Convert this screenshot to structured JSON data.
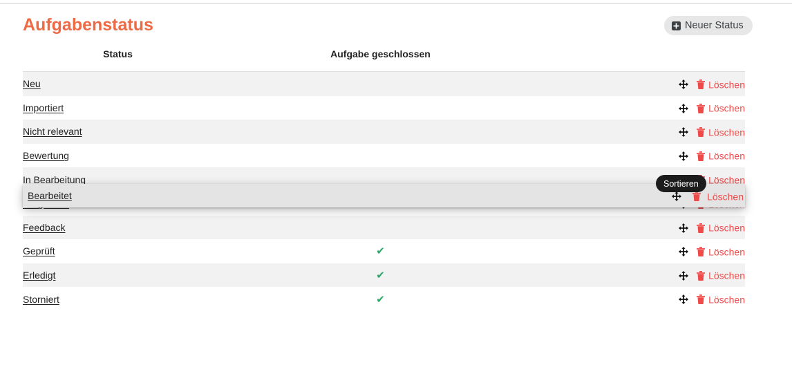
{
  "header": {
    "title": "Aufgabenstatus",
    "new_status_label": "Neuer Status",
    "new_status_icon": "plus-square-icon",
    "accent_color": "#ed6a45"
  },
  "table": {
    "columns": {
      "status": "Status",
      "closed": "Aufgabe geschlossen",
      "actions": ""
    },
    "row_action": {
      "move_icon": "move-arrows-icon",
      "delete_icon": "trash-icon",
      "delete_label": "Löschen"
    },
    "check_glyph": "✔",
    "check_color": "#28a766",
    "delete_color": "#ef4a4a",
    "rows": [
      {
        "status": "Neu",
        "closed": false
      },
      {
        "status": "Importiert",
        "closed": false
      },
      {
        "status": "Nicht relevant",
        "closed": false
      },
      {
        "status": "Bewertung",
        "closed": false
      },
      {
        "status": "In Bearbeitung",
        "closed": false
      },
      {
        "status": "Umgesetzt",
        "closed": false
      },
      {
        "status": "Feedback",
        "closed": false
      },
      {
        "status": "Geprüft",
        "closed": true
      },
      {
        "status": "Erledigt",
        "closed": true
      },
      {
        "status": "Storniert",
        "closed": true
      }
    ]
  },
  "drag": {
    "label": "Bearbeitet",
    "delete_label": "Löschen",
    "tooltip": "Sortieren"
  }
}
